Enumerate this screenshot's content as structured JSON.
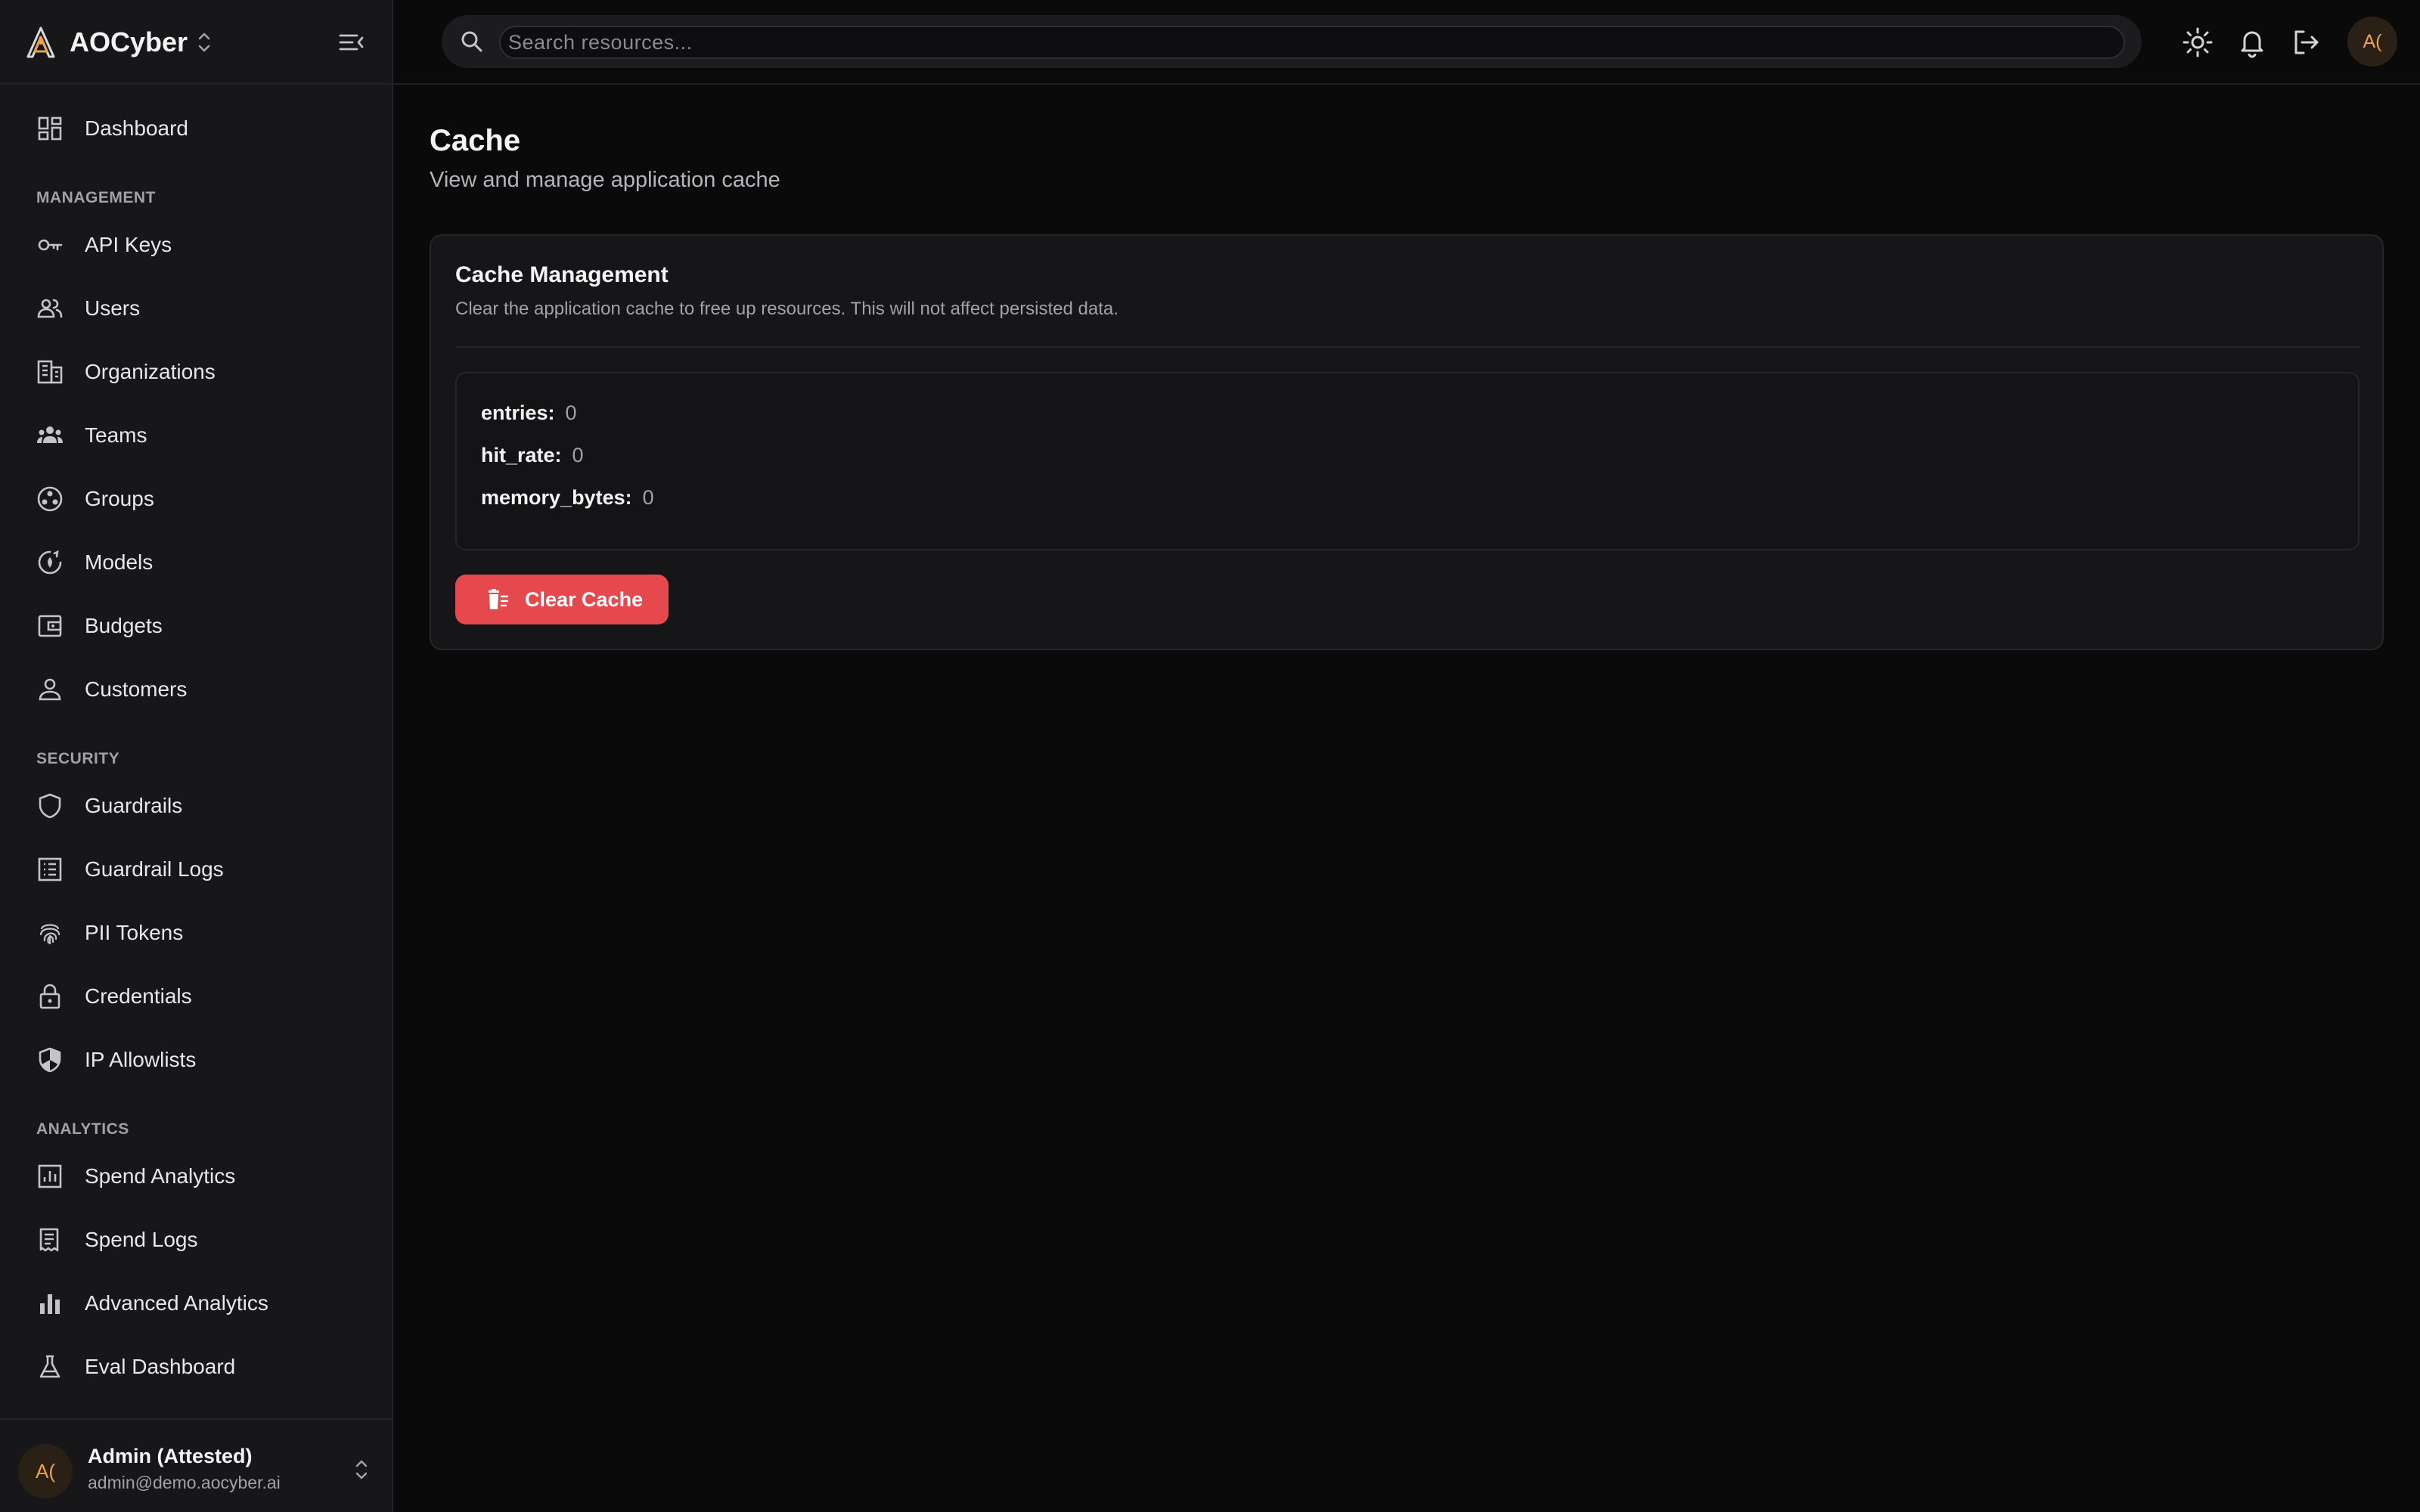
{
  "brand": {
    "name": "AOCyber"
  },
  "search": {
    "placeholder": "Search resources..."
  },
  "sidebar": {
    "dashboard": {
      "label": "Dashboard",
      "icon": "dashboard-icon"
    },
    "sections": [
      {
        "title": "MANAGEMENT",
        "items": [
          {
            "label": "API Keys",
            "icon": "key-icon"
          },
          {
            "label": "Users",
            "icon": "users-icon"
          },
          {
            "label": "Organizations",
            "icon": "building-icon"
          },
          {
            "label": "Teams",
            "icon": "teams-icon"
          },
          {
            "label": "Groups",
            "icon": "groups-icon"
          },
          {
            "label": "Models",
            "icon": "models-icon"
          },
          {
            "label": "Budgets",
            "icon": "wallet-icon"
          },
          {
            "label": "Customers",
            "icon": "person-icon"
          }
        ]
      },
      {
        "title": "SECURITY",
        "items": [
          {
            "label": "Guardrails",
            "icon": "shield-icon"
          },
          {
            "label": "Guardrail Logs",
            "icon": "list-icon"
          },
          {
            "label": "PII Tokens",
            "icon": "fingerprint-icon"
          },
          {
            "label": "Credentials",
            "icon": "lock-icon"
          },
          {
            "label": "IP Allowlists",
            "icon": "shield-half-icon"
          }
        ]
      },
      {
        "title": "ANALYTICS",
        "items": [
          {
            "label": "Spend Analytics",
            "icon": "analytics-icon"
          },
          {
            "label": "Spend Logs",
            "icon": "receipt-icon"
          },
          {
            "label": "Advanced Analytics",
            "icon": "bar-chart-icon"
          },
          {
            "label": "Eval Dashboard",
            "icon": "flask-icon"
          }
        ]
      }
    ]
  },
  "user": {
    "initials": "A(",
    "name": "Admin (Attested)",
    "email": "admin@demo.aocyber.ai"
  },
  "topbar": {
    "avatar_initials": "A(",
    "icons": [
      "sun-icon",
      "bell-icon",
      "logout-icon"
    ]
  },
  "page": {
    "title": "Cache",
    "subtitle": "View and manage application cache"
  },
  "card": {
    "title": "Cache Management",
    "description": "Clear the application cache to free up resources. This will not affect persisted data.",
    "stats": [
      {
        "key": "entries:",
        "value": "0"
      },
      {
        "key": "hit_rate:",
        "value": "0"
      },
      {
        "key": "memory_bytes:",
        "value": "0"
      }
    ],
    "button_label": "Clear Cache"
  },
  "colors": {
    "background": "#0a0a0a",
    "sidebar": "#171719",
    "danger": "#e5484d",
    "accent": "#e9a44a"
  }
}
